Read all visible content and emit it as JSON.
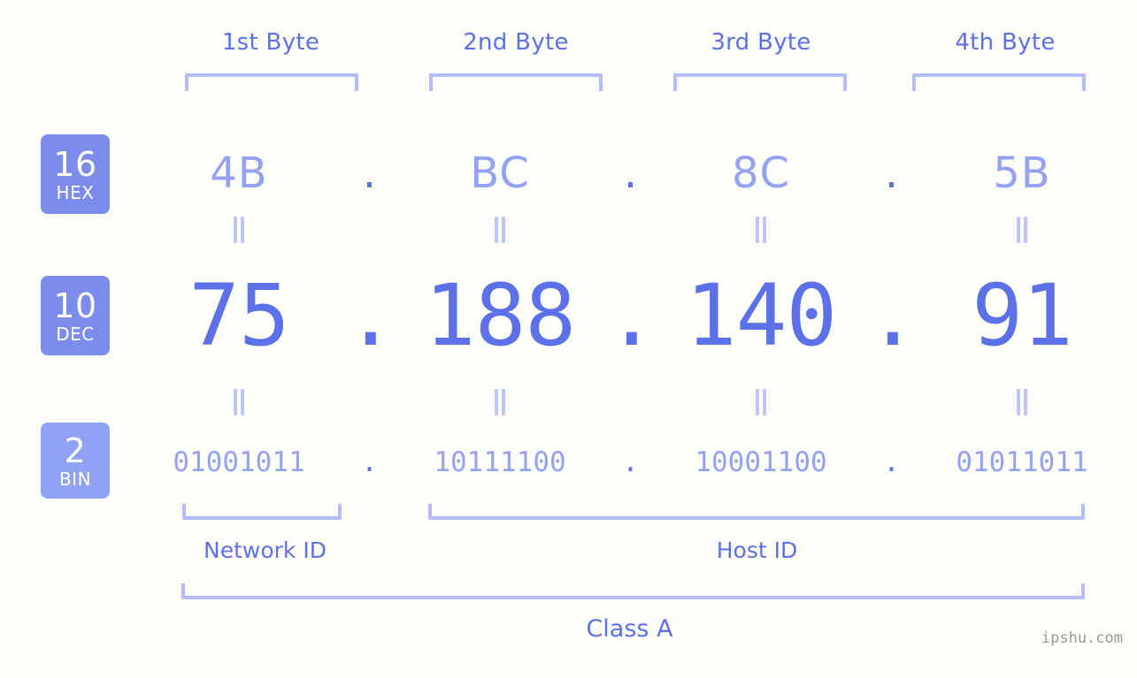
{
  "background_color": "#fdfefa",
  "colors": {
    "accent_strong": "#5c70e8",
    "accent_light": "#93a2f3",
    "bracket": "#b4bdf7",
    "equals": "#bcc4f8",
    "badge_hex": "#7b8cec",
    "badge_dec": "#7b8cec",
    "badge_bin": "#90a2f5",
    "watermark": "#999999"
  },
  "byte_headers": [
    {
      "label": "1st Byte"
    },
    {
      "label": "2nd Byte"
    },
    {
      "label": "3rd Byte"
    },
    {
      "label": "4th Byte"
    }
  ],
  "bases": [
    {
      "number": "16",
      "abbr": "HEX"
    },
    {
      "number": "10",
      "abbr": "DEC"
    },
    {
      "number": "2",
      "abbr": "BIN"
    }
  ],
  "separator": ".",
  "rows": {
    "hex": {
      "values": [
        "4B",
        "BC",
        "8C",
        "5B"
      ]
    },
    "dec": {
      "values": [
        "75",
        "188",
        "140",
        "91"
      ]
    },
    "bin": {
      "values": [
        "01001011",
        "10111100",
        "10001100",
        "01011011"
      ]
    }
  },
  "sections": [
    {
      "label": "Network ID"
    },
    {
      "label": "Host ID"
    }
  ],
  "class": {
    "label": "Class A"
  },
  "watermark": {
    "text": "ipshu.com"
  }
}
